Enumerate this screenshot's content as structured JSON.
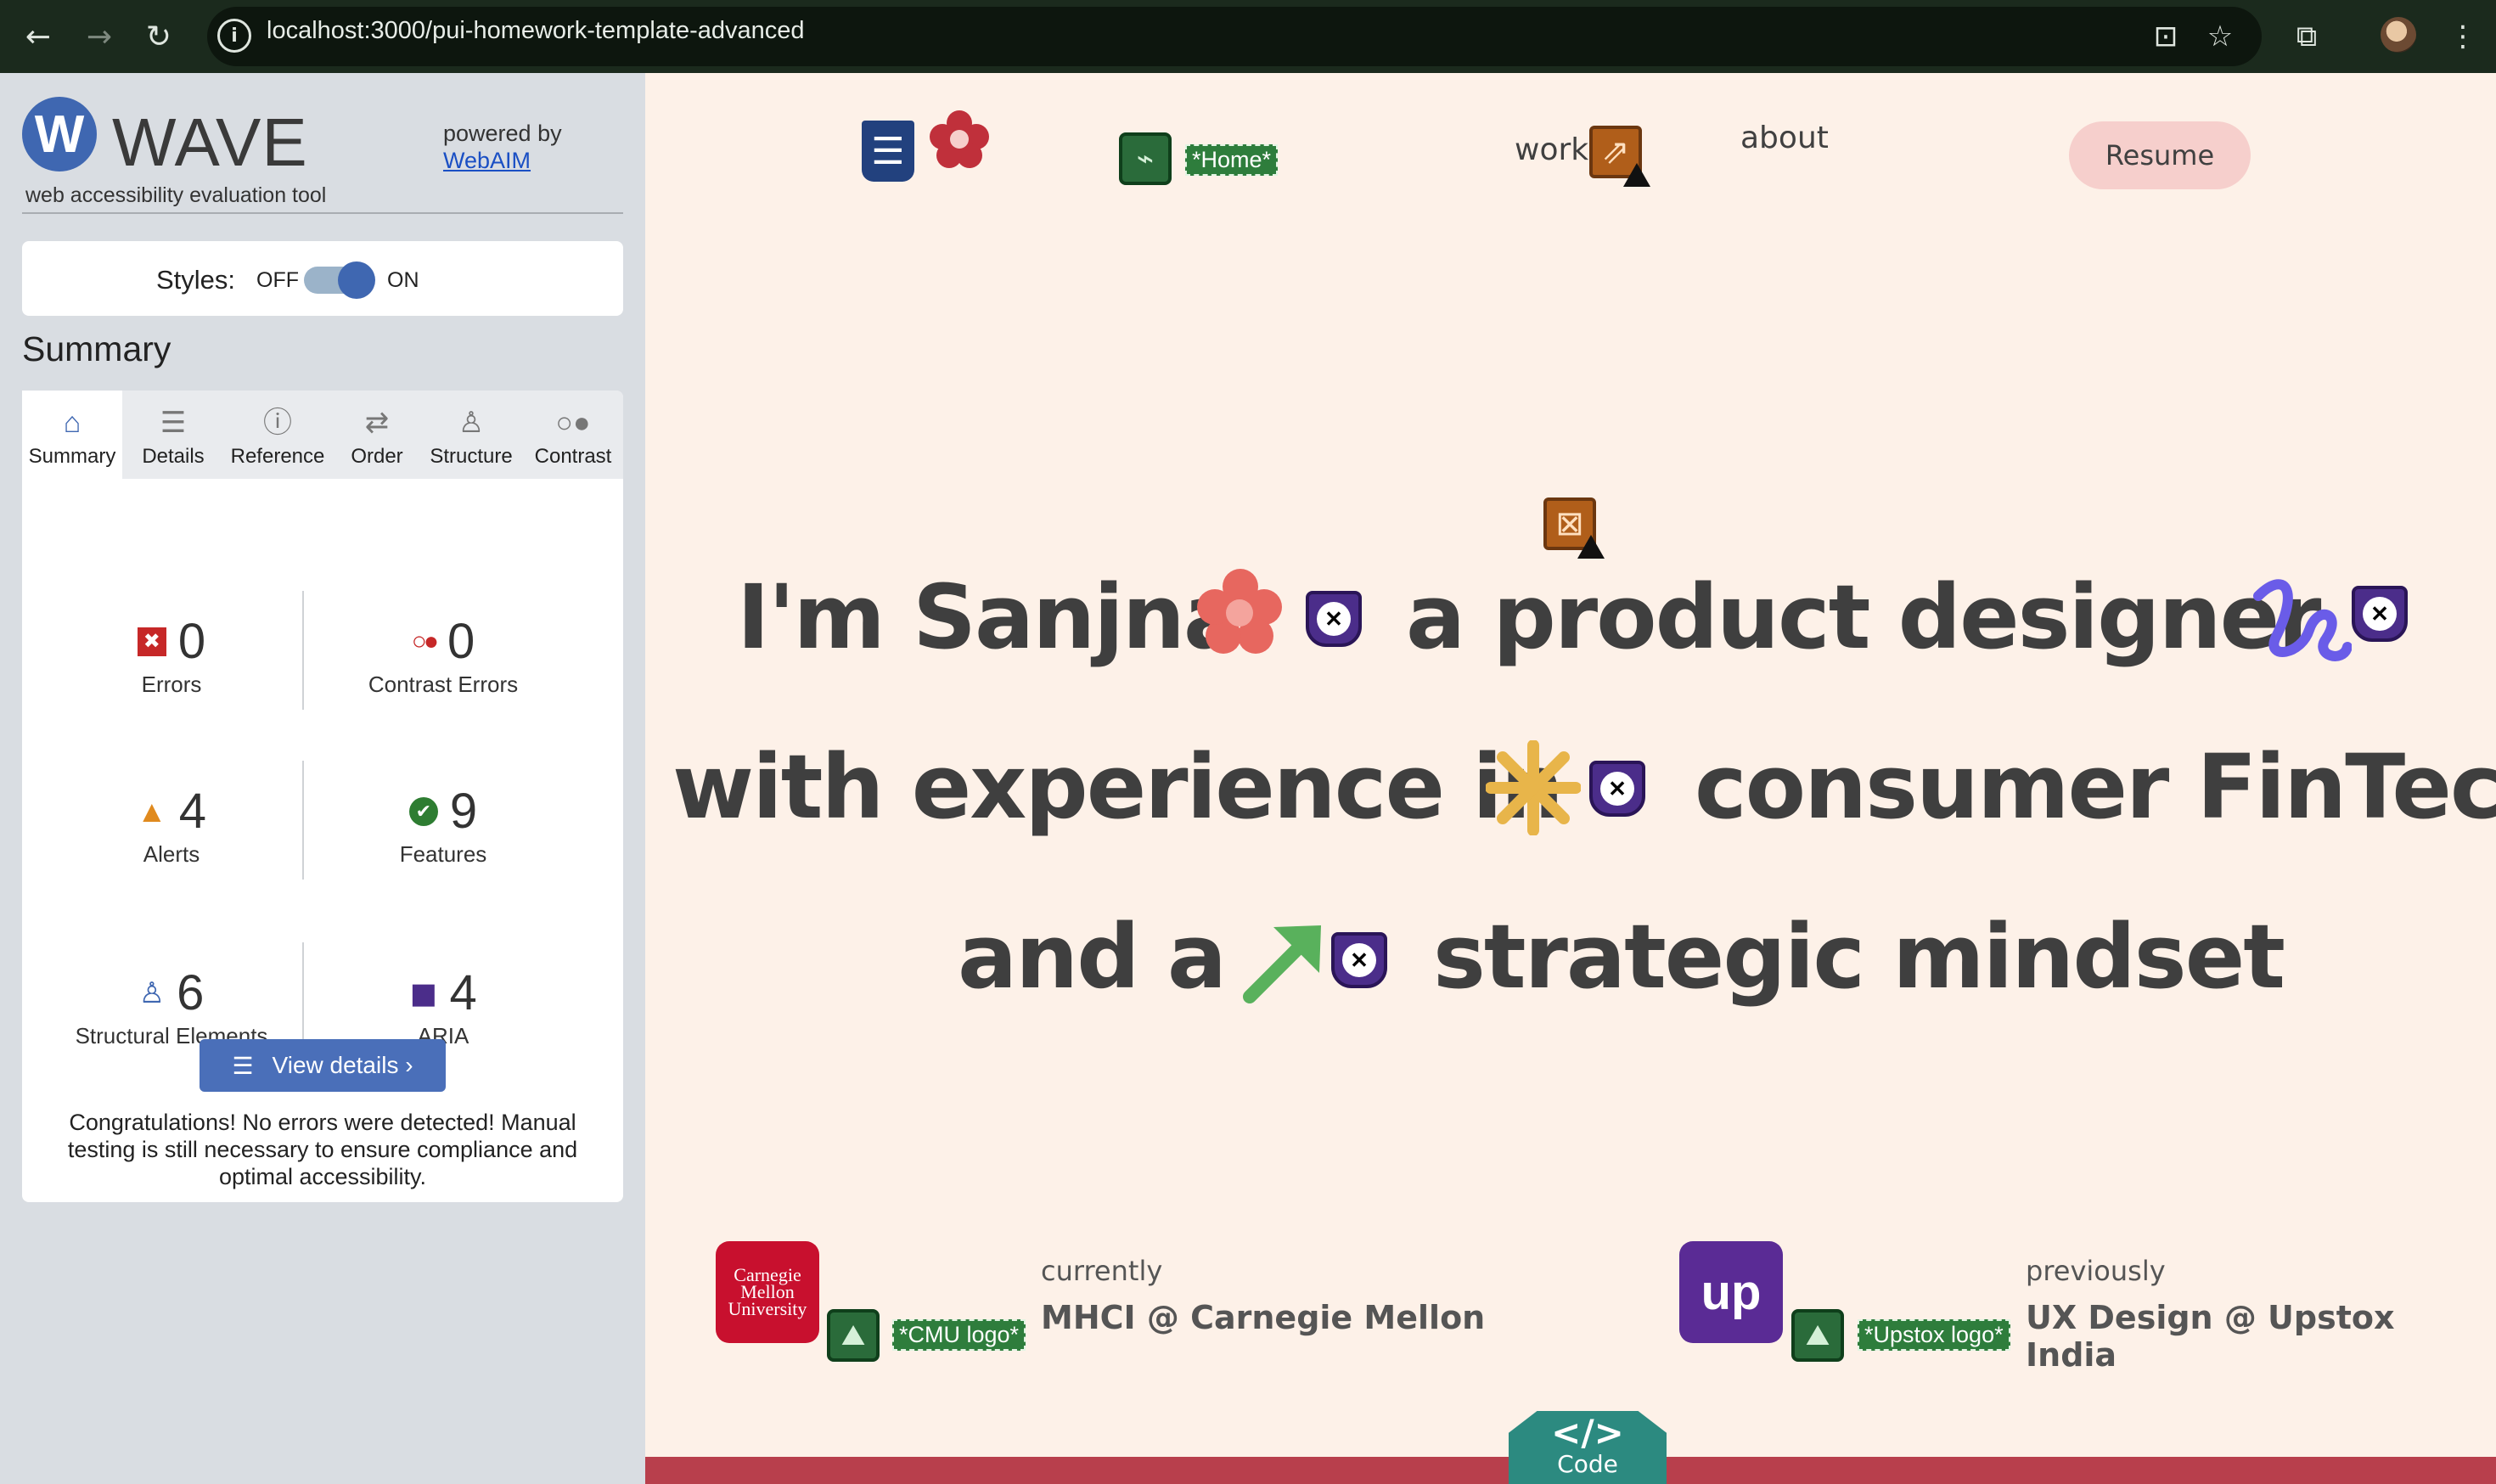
{
  "browser": {
    "url": "localhost:3000/pui-homework-template-advanced",
    "back_icon": "←",
    "forward_icon": "→",
    "reload_icon": "↻",
    "info_icon": "i",
    "install_icon": "⊡",
    "star_icon": "☆",
    "extensions_icon": "⧉",
    "menu_icon": "⋮"
  },
  "wave": {
    "logo_letter": "W",
    "title": "WAVE",
    "subtitle": "web accessibility evaluation tool",
    "powered_by": "powered by",
    "webaim": "WebAIM",
    "styles_label": "Styles:",
    "styles_off": "OFF",
    "styles_on": "ON",
    "summary_heading": "Summary",
    "tabs": [
      {
        "label": "Summary",
        "icon": "⌂"
      },
      {
        "label": "Details",
        "icon": "☰"
      },
      {
        "label": "Reference",
        "icon": "ⓘ"
      },
      {
        "label": "Order",
        "icon": "⇄"
      },
      {
        "label": "Structure",
        "icon": "♙"
      },
      {
        "label": "Contrast",
        "icon": "○●"
      }
    ],
    "stats": {
      "errors": {
        "value": "0",
        "label": "Errors",
        "icon": "✖"
      },
      "contrast": {
        "value": "0",
        "label": "Contrast Errors",
        "icon": "○●"
      },
      "alerts": {
        "value": "4",
        "label": "Alerts",
        "icon": "▲"
      },
      "features": {
        "value": "9",
        "label": "Features",
        "icon": "✔"
      },
      "structural": {
        "value": "6",
        "label": "Structural Elements",
        "icon": "♙"
      },
      "aria": {
        "value": "4",
        "label": "ARIA",
        "icon": "◼"
      }
    },
    "view_details": "View details ›",
    "view_details_icon": "☰",
    "congrats": "Congratulations! No errors were detected! Manual testing is still necessary to ensure compliance and optimal accessibility.",
    "colors": {
      "accent": "#3f67b1",
      "error": "#c62828",
      "alert": "#e08a1e",
      "feature": "#2e7d32",
      "aria": "#4b2d8a"
    }
  },
  "site": {
    "nav": {
      "home_tag": "*Home*",
      "work": "work",
      "about": "about",
      "resume": "Resume"
    },
    "hero": {
      "line1a": "I'm Sanjna",
      "line1b": "a product designer",
      "line2a": "with experience in",
      "line2b": "consumer FinTech",
      "line3a": "and a",
      "line3b": "strategic mindset"
    },
    "jobs": {
      "current_label": "currently",
      "current_role": "MHCI @ Carnegie Mellon",
      "current_logo_tag": "*CMU logo*",
      "cmu_logo_lines": [
        "Carnegie",
        "Mellon",
        "University"
      ],
      "previous_label": "previously",
      "previous_role": "UX Design @ Upstox India",
      "previous_logo_tag": "*Upstox logo*",
      "upstox_logo_text": "up"
    },
    "code_badge": {
      "glyph": "</>",
      "label": "Code"
    },
    "colors": {
      "background": "#fdf1e8",
      "flower": "#e7675f",
      "squiggle": "#6a5ce8",
      "asterisk": "#e8b54a",
      "arrow": "#59b15c",
      "footer": "#b83f4c",
      "resume_bg": "#f6cfcc"
    }
  }
}
